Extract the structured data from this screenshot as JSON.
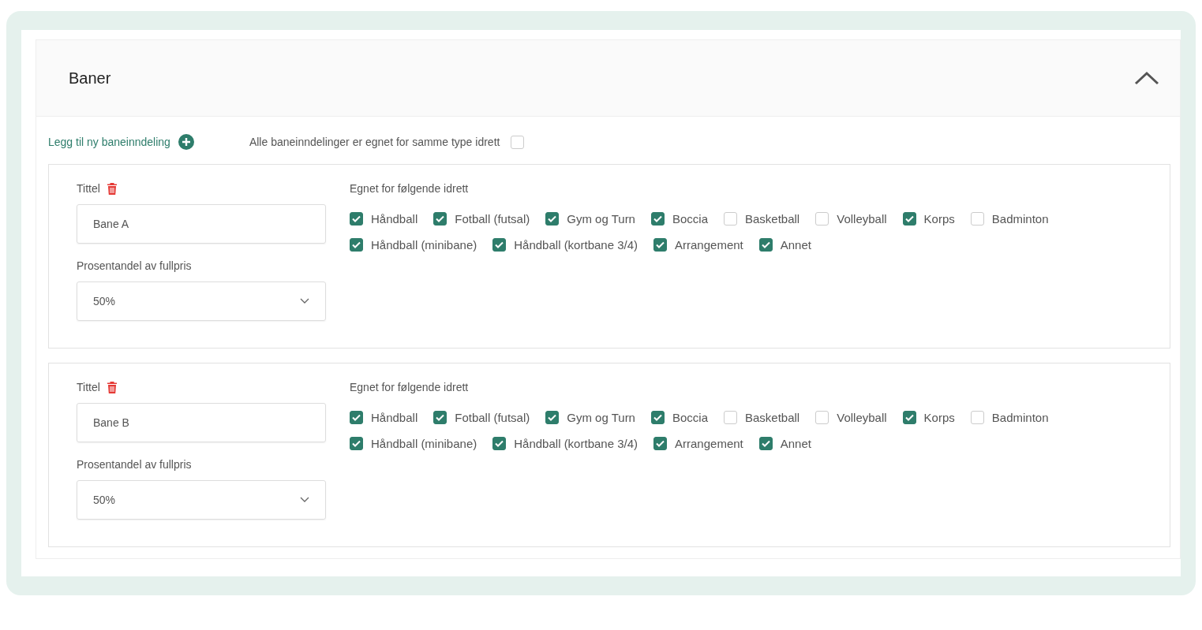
{
  "panel": {
    "title": "Baner",
    "expanded": true
  },
  "add_link": "Legg til ny baneinndeling",
  "same_sport": {
    "label": "Alle baneinndelinger er egnet for samme type idrett",
    "checked": false
  },
  "courts": [
    {
      "title_label": "Tittel",
      "title_value": "Bane A",
      "percent_label": "Prosentandel av fullpris",
      "percent_value": "50%",
      "sports_label": "Egnet for følgende idrett",
      "sports": [
        {
          "label": "Håndball",
          "checked": true
        },
        {
          "label": "Fotball (futsal)",
          "checked": true
        },
        {
          "label": "Gym og Turn",
          "checked": true
        },
        {
          "label": "Boccia",
          "checked": true
        },
        {
          "label": "Basketball",
          "checked": false
        },
        {
          "label": "Volleyball",
          "checked": false
        },
        {
          "label": "Korps",
          "checked": true
        },
        {
          "label": "Badminton",
          "checked": false
        },
        {
          "label": "Håndball (minibane)",
          "checked": true
        },
        {
          "label": "Håndball (kortbane 3/4)",
          "checked": true
        },
        {
          "label": "Arrangement",
          "checked": true
        },
        {
          "label": "Annet",
          "checked": true
        }
      ]
    },
    {
      "title_label": "Tittel",
      "title_value": "Bane B",
      "percent_label": "Prosentandel av fullpris",
      "percent_value": "50%",
      "sports_label": "Egnet for følgende idrett",
      "sports": [
        {
          "label": "Håndball",
          "checked": true
        },
        {
          "label": "Fotball (futsal)",
          "checked": true
        },
        {
          "label": "Gym og Turn",
          "checked": true
        },
        {
          "label": "Boccia",
          "checked": true
        },
        {
          "label": "Basketball",
          "checked": false
        },
        {
          "label": "Volleyball",
          "checked": false
        },
        {
          "label": "Korps",
          "checked": true
        },
        {
          "label": "Badminton",
          "checked": false
        },
        {
          "label": "Håndball (minibane)",
          "checked": true
        },
        {
          "label": "Håndball (kortbane 3/4)",
          "checked": true
        },
        {
          "label": "Arrangement",
          "checked": true
        },
        {
          "label": "Annet",
          "checked": true
        }
      ]
    }
  ]
}
